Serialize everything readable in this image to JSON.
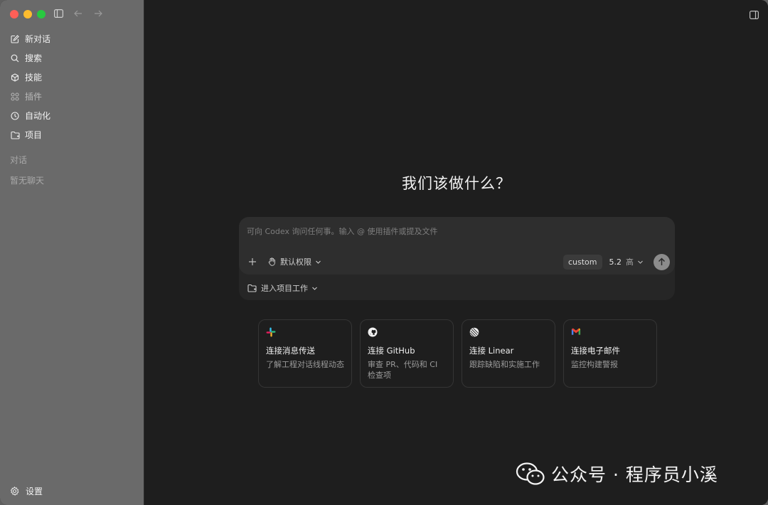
{
  "sidebar": {
    "nav": [
      {
        "label": "新对话",
        "icon": "edit-icon",
        "dim": false
      },
      {
        "label": "搜索",
        "icon": "search-icon",
        "dim": false
      },
      {
        "label": "技能",
        "icon": "cube-icon",
        "dim": false
      },
      {
        "label": "插件",
        "icon": "grid-icon",
        "dim": true
      },
      {
        "label": "自动化",
        "icon": "clock-icon",
        "dim": false
      },
      {
        "label": "项目",
        "icon": "folder-icon",
        "dim": false
      }
    ],
    "section_conversations": "对话",
    "empty_chats": "暂无聊天",
    "settings_label": "设置"
  },
  "main": {
    "title": "我们该做什么？",
    "composer": {
      "placeholder": "可向 Codex 询问任何事。输入 @ 使用插件或提及文件",
      "permission_label": "默认权限",
      "custom_label": "custom",
      "model_version": "5.2",
      "model_level": "高",
      "project_label": "进入项目工作"
    },
    "cards": [
      {
        "logo": "slack-icon",
        "title": "连接消息传送",
        "desc": "了解工程对话线程动态"
      },
      {
        "logo": "github-icon",
        "title": "连接 GitHub",
        "desc": "审查 PR、代码和 CI 检查项"
      },
      {
        "logo": "linear-icon",
        "title": "连接 Linear",
        "desc": "跟踪缺陷和实施工作"
      },
      {
        "logo": "gmail-icon",
        "title": "连接电子邮件",
        "desc": "监控构建警报"
      }
    ]
  },
  "watermark": {
    "text": "公众号 · 程序员小溪"
  },
  "colors": {
    "sidebar_bg": "#6a6a6a",
    "main_bg": "#1e1e1e",
    "composer_bg": "#2e2e2e"
  }
}
